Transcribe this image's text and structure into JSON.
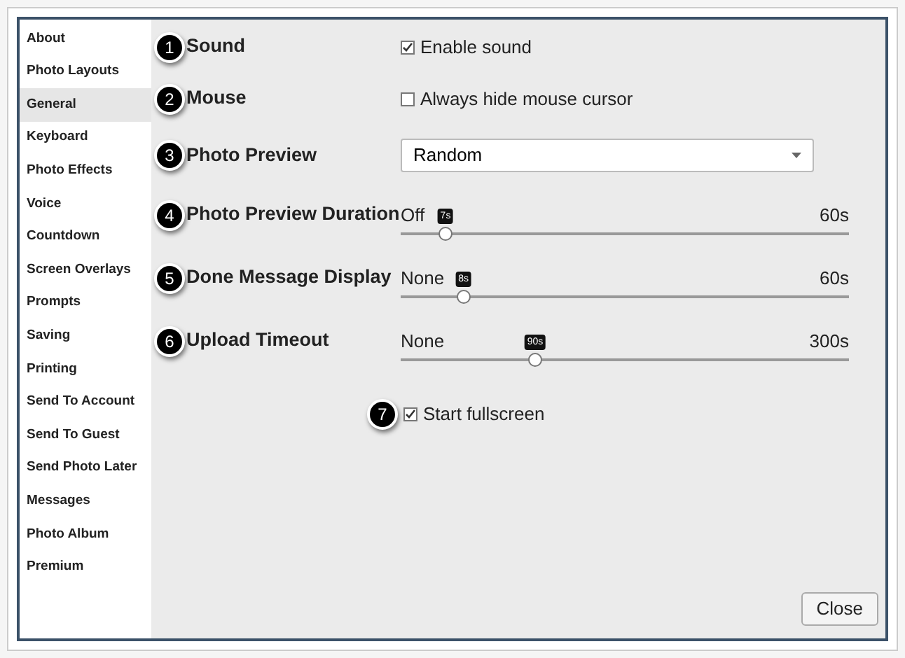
{
  "sidebar": {
    "items": [
      {
        "label": "About",
        "selected": false
      },
      {
        "label": "Photo Layouts",
        "selected": false
      },
      {
        "label": "General",
        "selected": true
      },
      {
        "label": "Keyboard",
        "selected": false
      },
      {
        "label": "Photo Effects",
        "selected": false
      },
      {
        "label": "Voice",
        "selected": false
      },
      {
        "label": "Countdown",
        "selected": false
      },
      {
        "label": "Screen Overlays",
        "selected": false
      },
      {
        "label": "Prompts",
        "selected": false
      },
      {
        "label": "Saving",
        "selected": false
      },
      {
        "label": "Printing",
        "selected": false
      },
      {
        "label": "Send To Account",
        "selected": false
      },
      {
        "label": "Send To Guest",
        "selected": false
      },
      {
        "label": "Send Photo Later",
        "selected": false
      },
      {
        "label": "Messages",
        "selected": false
      },
      {
        "label": "Photo Album",
        "selected": false
      },
      {
        "label": "Premium",
        "selected": false
      }
    ]
  },
  "settings": [
    {
      "kind": "checkbox",
      "number": "1",
      "label": "Sound",
      "option": "Enable sound",
      "checked": true
    },
    {
      "kind": "checkbox",
      "number": "2",
      "label": "Mouse",
      "option": "Always hide mouse cursor",
      "checked": false
    },
    {
      "kind": "select",
      "number": "3",
      "label": "Photo Preview",
      "value": "Random"
    },
    {
      "kind": "slider",
      "number": "4",
      "label": "Photo Preview Duration",
      "min": "Off",
      "max": "60s",
      "bubble": "7s",
      "level": 0.1
    },
    {
      "kind": "slider",
      "number": "5",
      "label": "Done Message Display",
      "min": "None",
      "max": "60s",
      "bubble": "8s",
      "level": 0.14
    },
    {
      "kind": "slider",
      "number": "6",
      "label": "Upload Timeout",
      "min": "None",
      "max": "300s",
      "bubble": "90s",
      "level": 0.3
    },
    {
      "kind": "standalone",
      "number": "7",
      "option": "Start fullscreen",
      "checked": true
    }
  ],
  "close_button": "Close"
}
